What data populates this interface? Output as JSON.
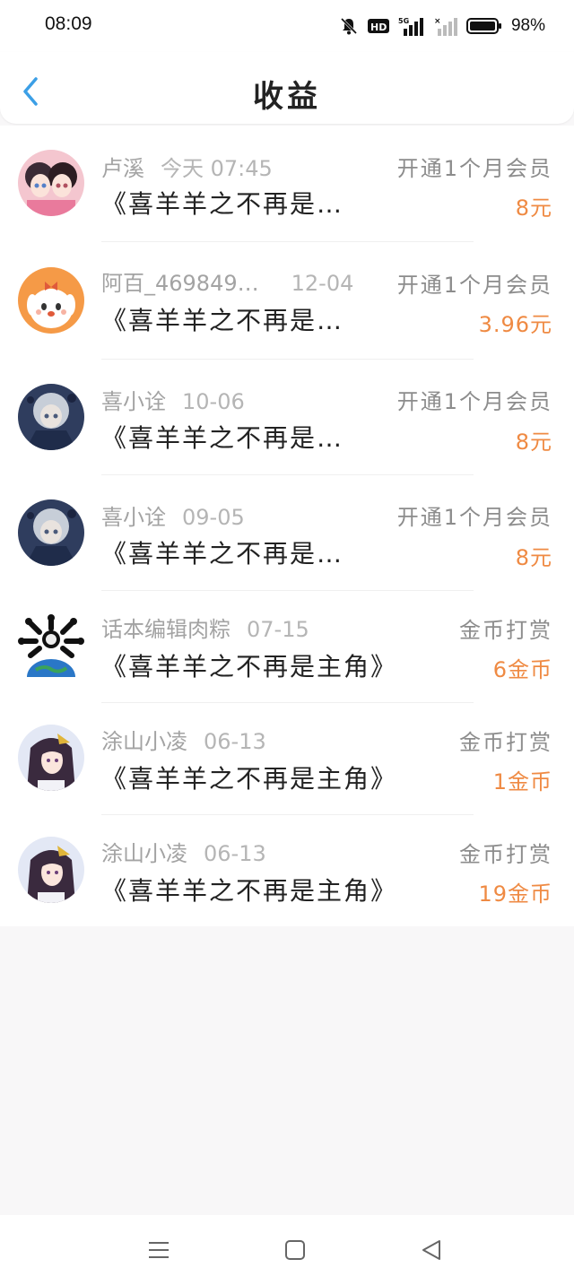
{
  "status": {
    "time": "08:09",
    "battery": "98%",
    "icons": [
      "bell-muted-icon",
      "hd-icon",
      "5g-signal-icon",
      "signal-off-icon",
      "battery-icon"
    ]
  },
  "header": {
    "title": "收益",
    "back_icon": "chevron-left-icon"
  },
  "colors": {
    "accent": "#3b9fe6",
    "amount": "#ef8a43",
    "muted_text": "#a3a3a3"
  },
  "earnings": [
    {
      "name": "卢溪",
      "date": "今天 07:45",
      "title": "《喜羊羊之不再是…",
      "type": "开通1个月会员",
      "amount": "8元"
    },
    {
      "name": "阿百_469849…",
      "date": "12-04",
      "title": "《喜羊羊之不再是…",
      "type": "开通1个月会员",
      "amount": "3.96元"
    },
    {
      "name": "喜小诠",
      "date": "10-06",
      "title": "《喜羊羊之不再是…",
      "type": "开通1个月会员",
      "amount": "8元"
    },
    {
      "name": "喜小诠",
      "date": "09-05",
      "title": "《喜羊羊之不再是…",
      "type": "开通1个月会员",
      "amount": "8元"
    },
    {
      "name": "话本编辑肉粽",
      "date": "07-15",
      "title": "《喜羊羊之不再是主角》",
      "type": "金币打赏",
      "amount": "6金币"
    },
    {
      "name": "涂山小凌",
      "date": "06-13",
      "title": "《喜羊羊之不再是主角》",
      "type": "金币打赏",
      "amount": "1金币"
    },
    {
      "name": "涂山小凌",
      "date": "06-13",
      "title": "《喜羊羊之不再是主角》",
      "type": "金币打赏",
      "amount": "19金币"
    }
  ],
  "nav": {
    "icons": [
      "menu-icon",
      "home-square-icon",
      "back-triangle-icon"
    ]
  }
}
